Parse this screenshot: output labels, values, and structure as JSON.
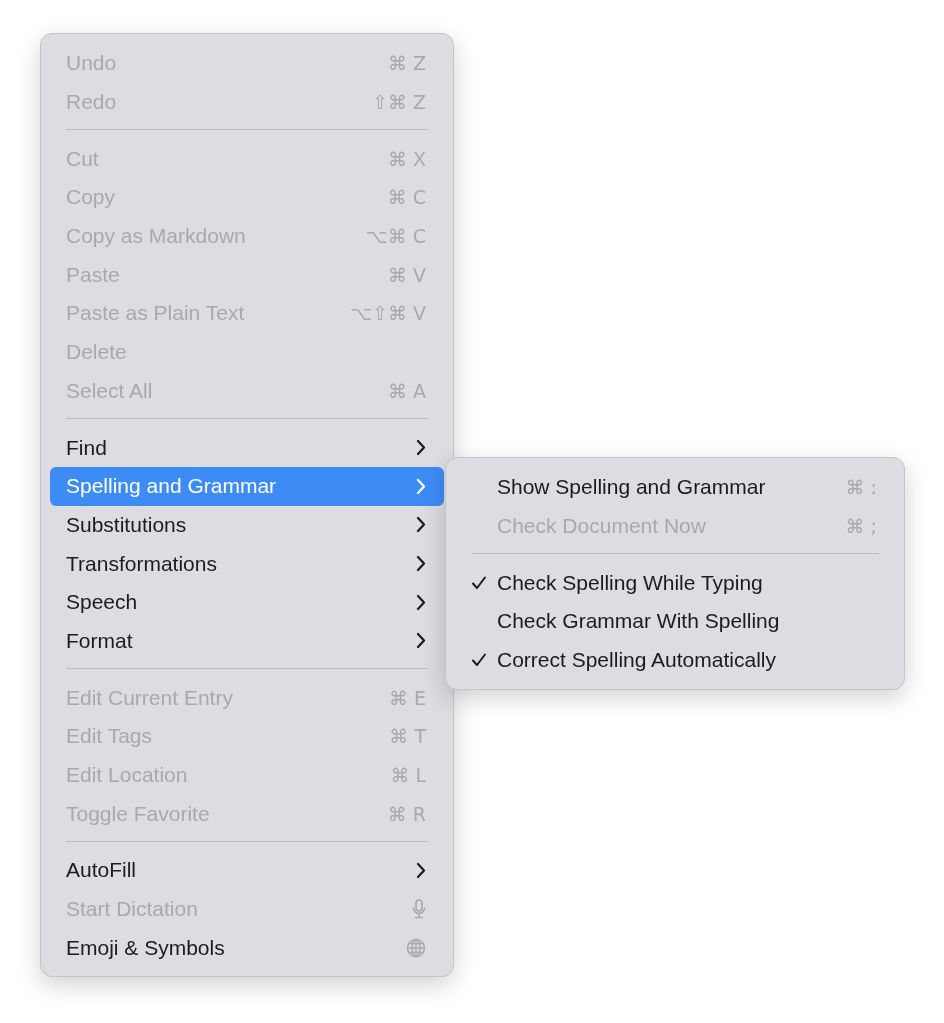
{
  "menu": {
    "items": [
      {
        "kind": "command",
        "label": "Undo",
        "shortcut": "⌘ Z",
        "disabled": true,
        "selected": false
      },
      {
        "kind": "command",
        "label": "Redo",
        "shortcut": "⇧⌘ Z",
        "disabled": true,
        "selected": false
      },
      {
        "kind": "separator"
      },
      {
        "kind": "command",
        "label": "Cut",
        "shortcut": "⌘ X",
        "disabled": true,
        "selected": false
      },
      {
        "kind": "command",
        "label": "Copy",
        "shortcut": "⌘ C",
        "disabled": true,
        "selected": false
      },
      {
        "kind": "command",
        "label": "Copy as Markdown",
        "shortcut": "⌥⌘ C",
        "disabled": true,
        "selected": false
      },
      {
        "kind": "command",
        "label": "Paste",
        "shortcut": "⌘ V",
        "disabled": true,
        "selected": false
      },
      {
        "kind": "command",
        "label": "Paste as Plain Text",
        "shortcut": "⌥⇧⌘ V",
        "disabled": true,
        "selected": false
      },
      {
        "kind": "command",
        "label": "Delete",
        "disabled": true,
        "selected": false
      },
      {
        "kind": "command",
        "label": "Select All",
        "shortcut": "⌘ A",
        "disabled": true,
        "selected": false
      },
      {
        "kind": "separator"
      },
      {
        "kind": "submenu",
        "label": "Find",
        "disabled": false,
        "selected": false
      },
      {
        "kind": "submenu",
        "label": "Spelling and Grammar",
        "disabled": false,
        "selected": true
      },
      {
        "kind": "submenu",
        "label": "Substitutions",
        "disabled": false,
        "selected": false
      },
      {
        "kind": "submenu",
        "label": "Transformations",
        "disabled": false,
        "selected": false
      },
      {
        "kind": "submenu",
        "label": "Speech",
        "disabled": false,
        "selected": false
      },
      {
        "kind": "submenu",
        "label": "Format",
        "disabled": false,
        "selected": false
      },
      {
        "kind": "separator"
      },
      {
        "kind": "command",
        "label": "Edit Current Entry",
        "shortcut": "⌘ E",
        "disabled": true,
        "selected": false
      },
      {
        "kind": "command",
        "label": "Edit Tags",
        "shortcut": "⌘ T",
        "disabled": true,
        "selected": false
      },
      {
        "kind": "command",
        "label": "Edit Location",
        "shortcut": "⌘ L",
        "disabled": true,
        "selected": false
      },
      {
        "kind": "command",
        "label": "Toggle Favorite",
        "shortcut": "⌘ R",
        "disabled": true,
        "selected": false
      },
      {
        "kind": "separator"
      },
      {
        "kind": "submenu",
        "label": "AutoFill",
        "disabled": false,
        "selected": false
      },
      {
        "kind": "mic",
        "label": "Start Dictation",
        "disabled": true,
        "selected": false
      },
      {
        "kind": "globe",
        "label": "Emoji & Symbols",
        "disabled": false,
        "selected": false
      }
    ]
  },
  "submenu": {
    "items": [
      {
        "kind": "command",
        "label": "Show Spelling and Grammar",
        "shortcut": "⌘ :",
        "disabled": false,
        "checked": false
      },
      {
        "kind": "command",
        "label": "Check Document Now",
        "shortcut": "⌘ ;",
        "disabled": true,
        "checked": false
      },
      {
        "kind": "separator"
      },
      {
        "kind": "command",
        "label": "Check Spelling While Typing",
        "disabled": false,
        "checked": true
      },
      {
        "kind": "command",
        "label": "Check Grammar With Spelling",
        "disabled": false,
        "checked": false
      },
      {
        "kind": "command",
        "label": "Correct Spelling Automatically",
        "disabled": false,
        "checked": true
      }
    ]
  }
}
